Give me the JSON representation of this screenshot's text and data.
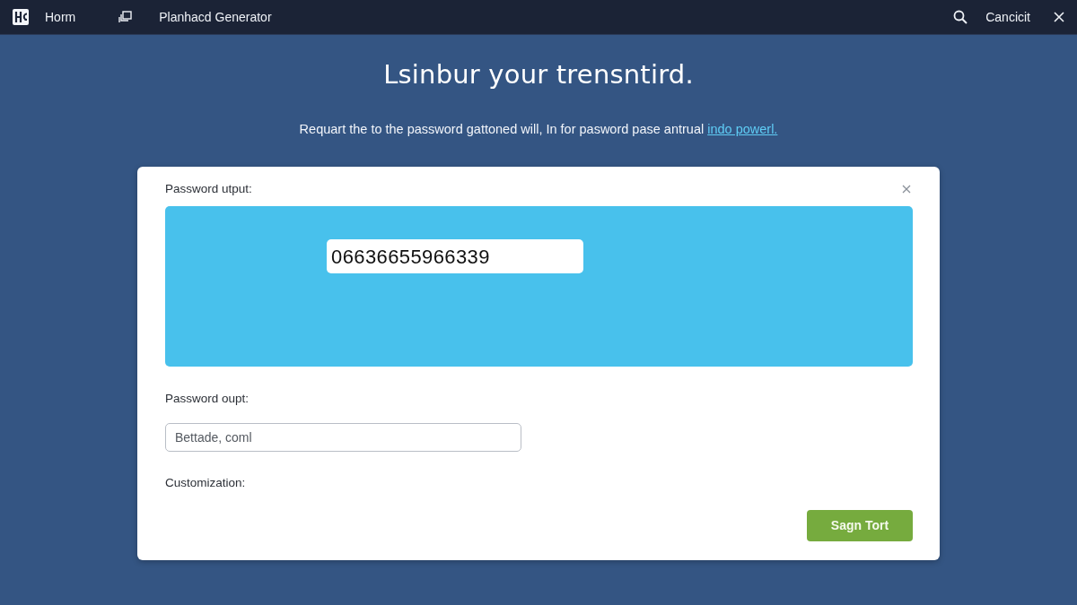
{
  "navbar": {
    "home_label": "Horm",
    "app_title": "Planhacd Generator",
    "account_label": "Cancicit"
  },
  "heading": "Lsinbur your trensntird.",
  "intro": {
    "text": "Requart the to the password gattoned will, In for pasword pase antrual ",
    "link": "indo powerl."
  },
  "dialog": {
    "output_label": "Password utput:",
    "password": "06636655966339",
    "second_label": "Password oupt:",
    "second_field": {
      "placeholder": "Bettade, coml"
    },
    "customization_label": "Customization:",
    "action_button": "Sagn Tort"
  }
}
